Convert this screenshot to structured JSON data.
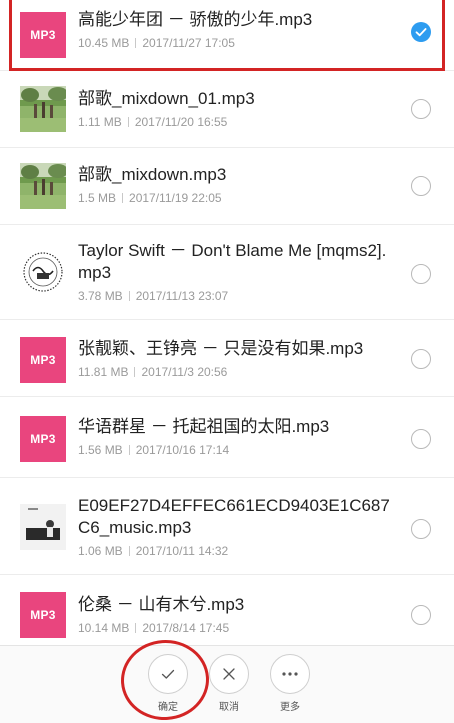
{
  "files": [
    {
      "title": "高能少年团 － 骄傲的少年.mp3",
      "size": "10.45 MB",
      "date": "2017/11/27 17:05",
      "thumb": "mp3",
      "thumb_label": "MP3",
      "selected": true
    },
    {
      "title": "部歌_mixdown_01.mp3",
      "size": "1.11 MB",
      "date": "2017/11/20 16:55",
      "thumb": "photo",
      "selected": false
    },
    {
      "title": "部歌_mixdown.mp3",
      "size": "1.5 MB",
      "date": "2017/11/19 22:05",
      "thumb": "photo",
      "selected": false
    },
    {
      "title": "Taylor Swift － Don't Blame Me [mqms2].mp3",
      "size": "3.78 MB",
      "date": "2017/11/13 23:07",
      "thumb": "disc",
      "selected": false
    },
    {
      "title": "张靓颖、王铮亮 － 只是没有如果.mp3",
      "size": "11.81 MB",
      "date": "2017/11/3 20:56",
      "thumb": "mp3",
      "thumb_label": "MP3",
      "selected": false
    },
    {
      "title": "华语群星 － 托起祖国的太阳.mp3",
      "size": "1.56 MB",
      "date": "2017/10/16 17:14",
      "thumb": "mp3",
      "thumb_label": "MP3",
      "selected": false
    },
    {
      "title": "E09EF27D4EFFEC661ECD9403E1C687C6_music.mp3",
      "size": "1.06 MB",
      "date": "2017/10/11 14:32",
      "thumb": "album",
      "selected": false
    },
    {
      "title": "伦桑 － 山有木兮.mp3",
      "size": "10.14 MB",
      "date": "2017/8/14 17:45",
      "thumb": "mp3",
      "thumb_label": "MP3",
      "selected": false
    }
  ],
  "toolbar": {
    "confirm_label": "确定",
    "cancel_label": "取消",
    "more_label": "更多"
  },
  "colors": {
    "mp3_badge": "#e9457e",
    "check_blue": "#2d9cf0",
    "annotation_red": "#d32424"
  }
}
